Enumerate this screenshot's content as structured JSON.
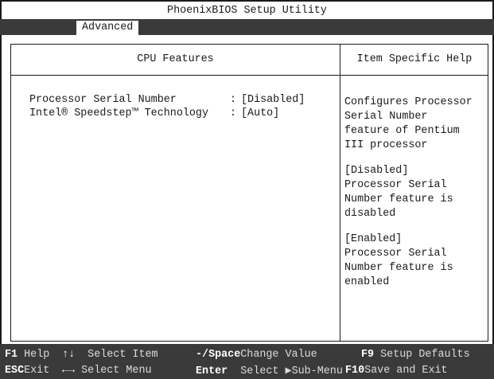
{
  "title": "PhoenixBIOS Setup Utility",
  "menu": {
    "active_tab": "Advanced"
  },
  "main": {
    "panel_title": "CPU Features",
    "settings": [
      {
        "label": "Processor Serial Number",
        "separator": ":",
        "value": "[Disabled]"
      },
      {
        "label": "Intel® Speedstep™ Technology",
        "separator": ":",
        "value": "[Auto]"
      }
    ]
  },
  "help": {
    "title": "Item Specific Help",
    "paragraphs": [
      "Configures Processor\nSerial Number\nfeature of Pentium\nIII processor",
      "[Disabled]\nProcessor Serial\nNumber feature is\ndisabled",
      "[Enabled]\nProcessor Serial\nNumber feature is\nenabled"
    ]
  },
  "footer": {
    "row1": [
      {
        "key": "F1",
        "label": "Help"
      },
      {
        "key": "↑↓",
        "label": "Select Item"
      },
      {
        "key": "-/Space",
        "label": "Change Value"
      },
      {
        "key": "F9",
        "label": "Setup Defaults"
      }
    ],
    "row2": [
      {
        "key": "ESC",
        "label": "Exit"
      },
      {
        "key": "←→",
        "label": "Select Menu"
      },
      {
        "key": "Enter",
        "label": "Select ▶Sub-Menu"
      },
      {
        "key": "F10",
        "label": "Save and Exit"
      }
    ]
  }
}
